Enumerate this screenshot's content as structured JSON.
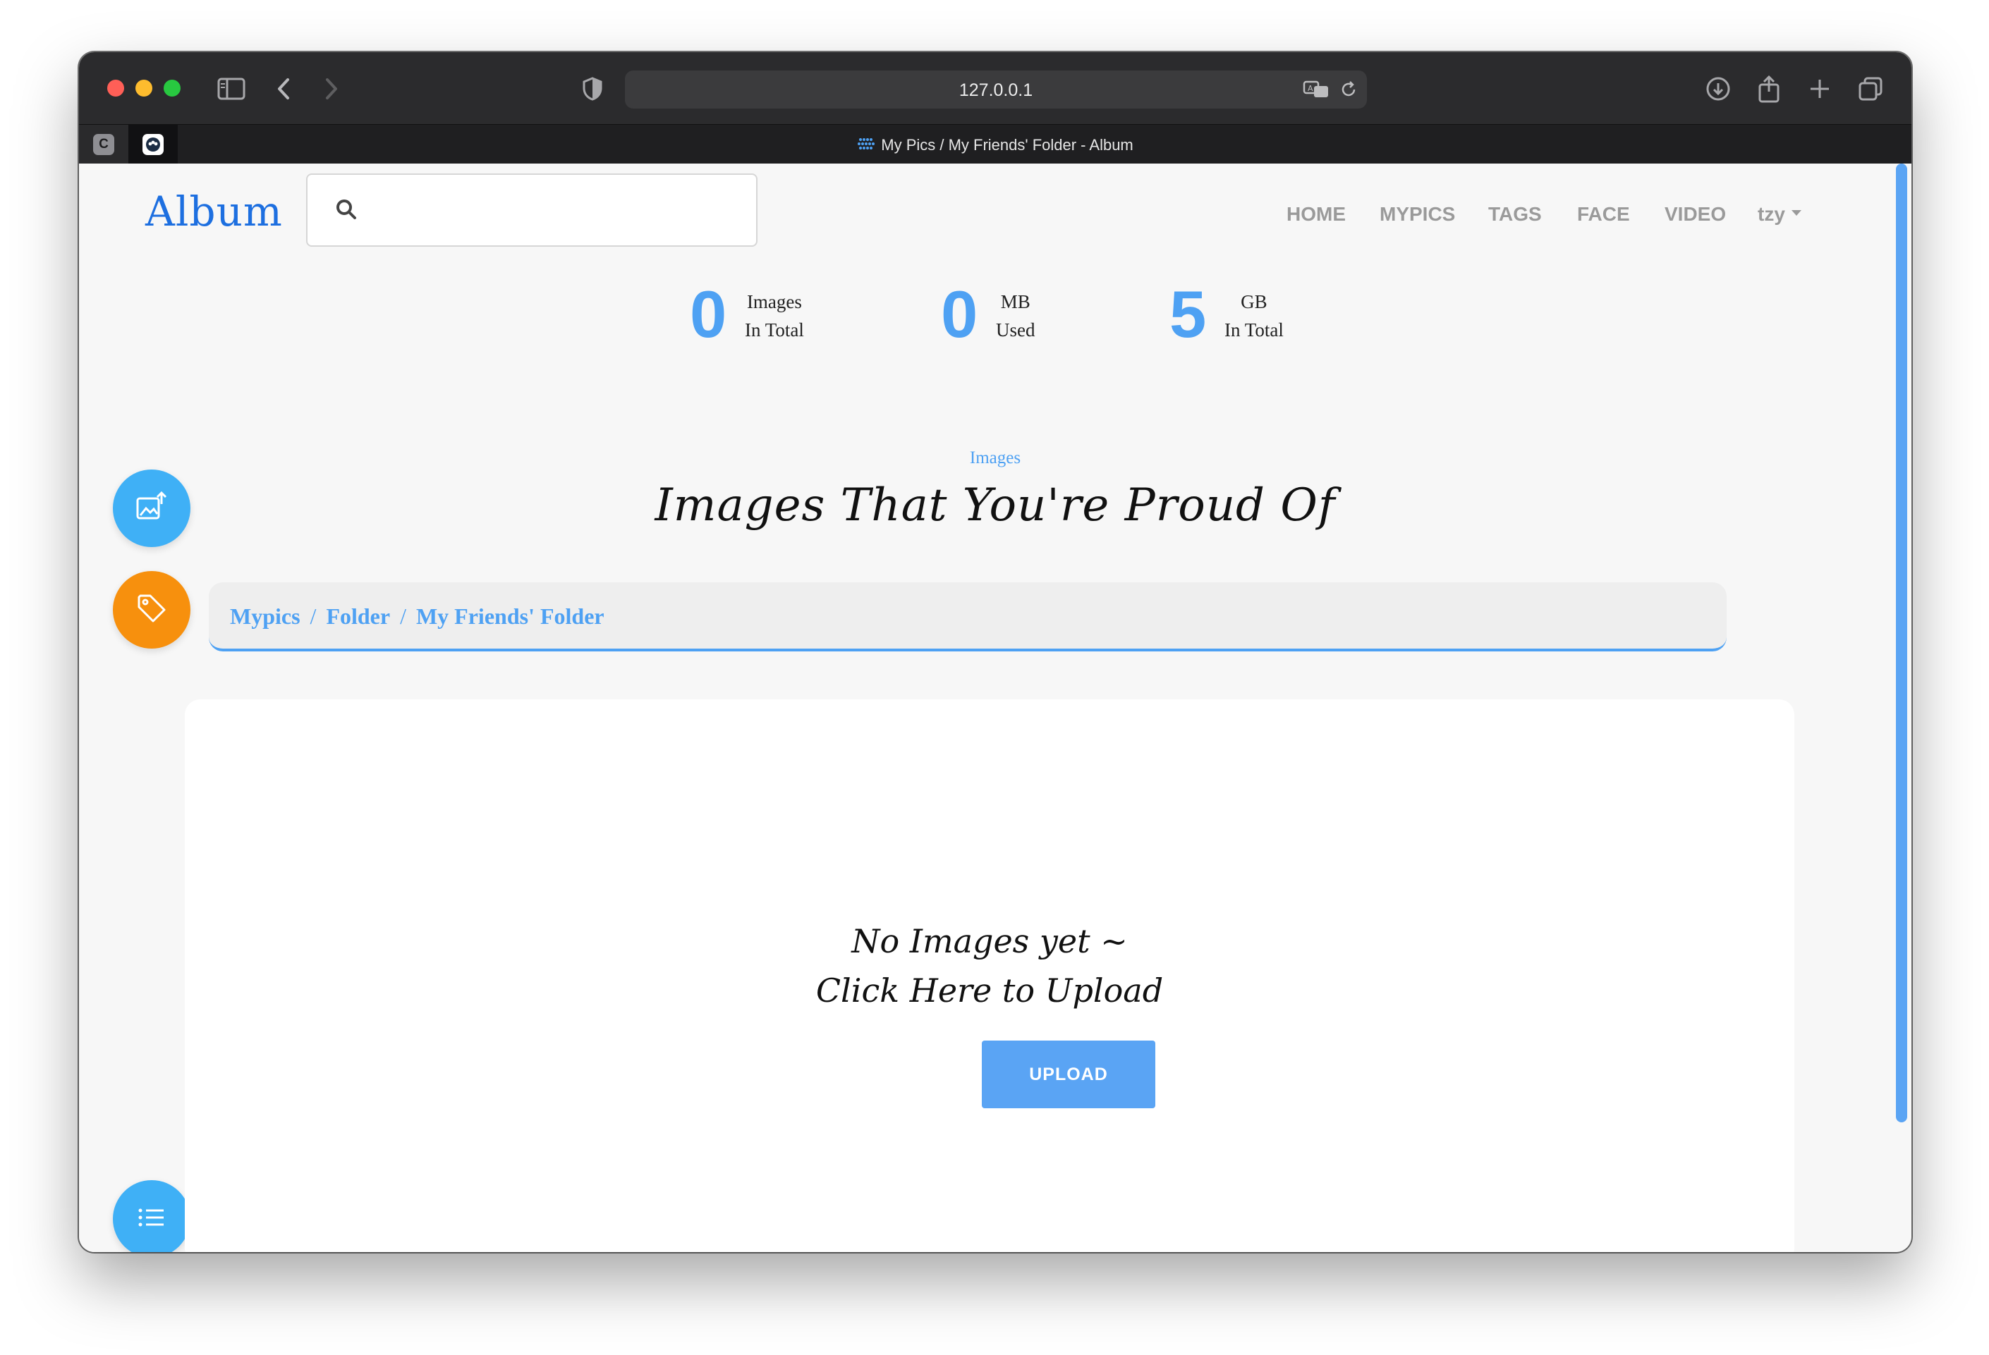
{
  "browser": {
    "url": "127.0.0.1",
    "tab_title": "My Pics / My Friends' Folder - Album",
    "pinned_tab_letter": "C"
  },
  "header": {
    "logo": "Album",
    "search_placeholder": "",
    "nav": [
      "HOME",
      "MYPICS",
      "TAGS",
      "FACE",
      "VIDEO"
    ],
    "user": "tzy"
  },
  "stats": [
    {
      "value": "0",
      "line1": "Images",
      "line2": "In Total"
    },
    {
      "value": "0",
      "line1": "MB",
      "line2": "Used"
    },
    {
      "value": "5",
      "line1": "GB",
      "line2": "In Total"
    }
  ],
  "section": {
    "eyebrow": "Images",
    "headline": "Images That You're Proud Of"
  },
  "breadcrumb": [
    "Mypics",
    "Folder",
    "My Friends' Folder"
  ],
  "empty_state": {
    "line1": "No Images yet ~",
    "line2": "Click Here to Upload",
    "button": "UPLOAD"
  },
  "colors": {
    "accent": "#4ea1f3",
    "fab_blue": "#3fb0f6",
    "fab_orange": "#f7900d"
  }
}
